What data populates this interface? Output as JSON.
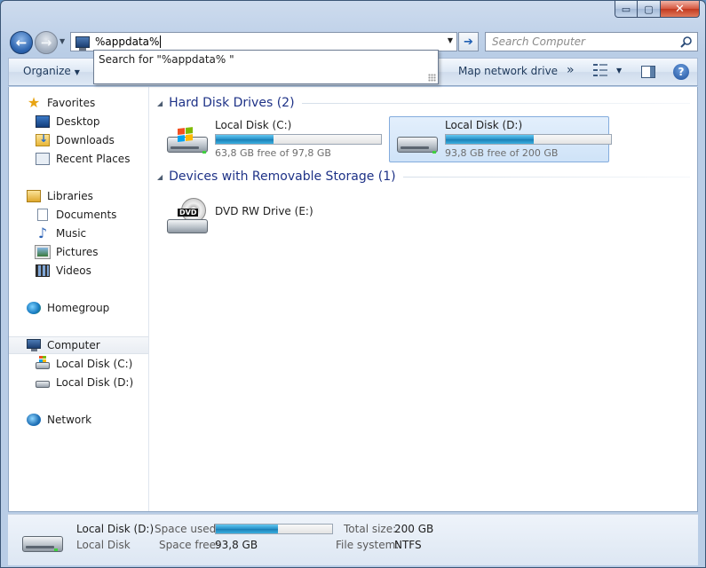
{
  "window": {
    "caption_buttons": {
      "minimize": "▭",
      "maximize": "▢",
      "close": "✕"
    }
  },
  "nav": {
    "back_glyph": "←",
    "forward_glyph": "→",
    "address_value": "%appdata%",
    "go_glyph": "➔",
    "search_placeholder": "Search Computer"
  },
  "autocomplete": {
    "item": "Search for \"%appdata% \""
  },
  "toolbar": {
    "organize": "Organize",
    "map_network_drive": "Map network drive",
    "more": "»",
    "help": "?"
  },
  "sidebar": {
    "favorites": {
      "label": "Favorites",
      "items": [
        "Desktop",
        "Downloads",
        "Recent Places"
      ]
    },
    "libraries": {
      "label": "Libraries",
      "items": [
        "Documents",
        "Music",
        "Pictures",
        "Videos"
      ]
    },
    "homegroup": "Homegroup",
    "computer": {
      "label": "Computer",
      "items": [
        "Local Disk (C:)",
        "Local Disk (D:)"
      ]
    },
    "network": "Network"
  },
  "main": {
    "hard_disk_header": "Hard Disk Drives (2)",
    "removable_header": "Devices with Removable Storage (1)",
    "drives": [
      {
        "name": "Local Disk (C:)",
        "free_text": "63,8 GB free of 97,8 GB",
        "used_fraction": 0.348,
        "selected": false
      },
      {
        "name": "Local Disk (D:)",
        "free_text": "93,8 GB free of 200 GB",
        "used_fraction": 0.531,
        "selected": true
      }
    ],
    "dvd": {
      "name": "DVD RW Drive (E:)",
      "label": "DVD"
    }
  },
  "details": {
    "name": "Local Disk (D:)",
    "type": "Local Disk",
    "space_used_label": "Space used:",
    "space_used_fraction": 0.531,
    "space_free_label": "Space free:",
    "space_free_value": "93,8 GB",
    "total_size_label": "Total size:",
    "total_size_value": "200 GB",
    "file_system_label": "File system:",
    "file_system_value": "NTFS"
  },
  "colors": {
    "accent": "#1e3287",
    "progress": "#2691c8",
    "selection": "#cfe3f8"
  }
}
